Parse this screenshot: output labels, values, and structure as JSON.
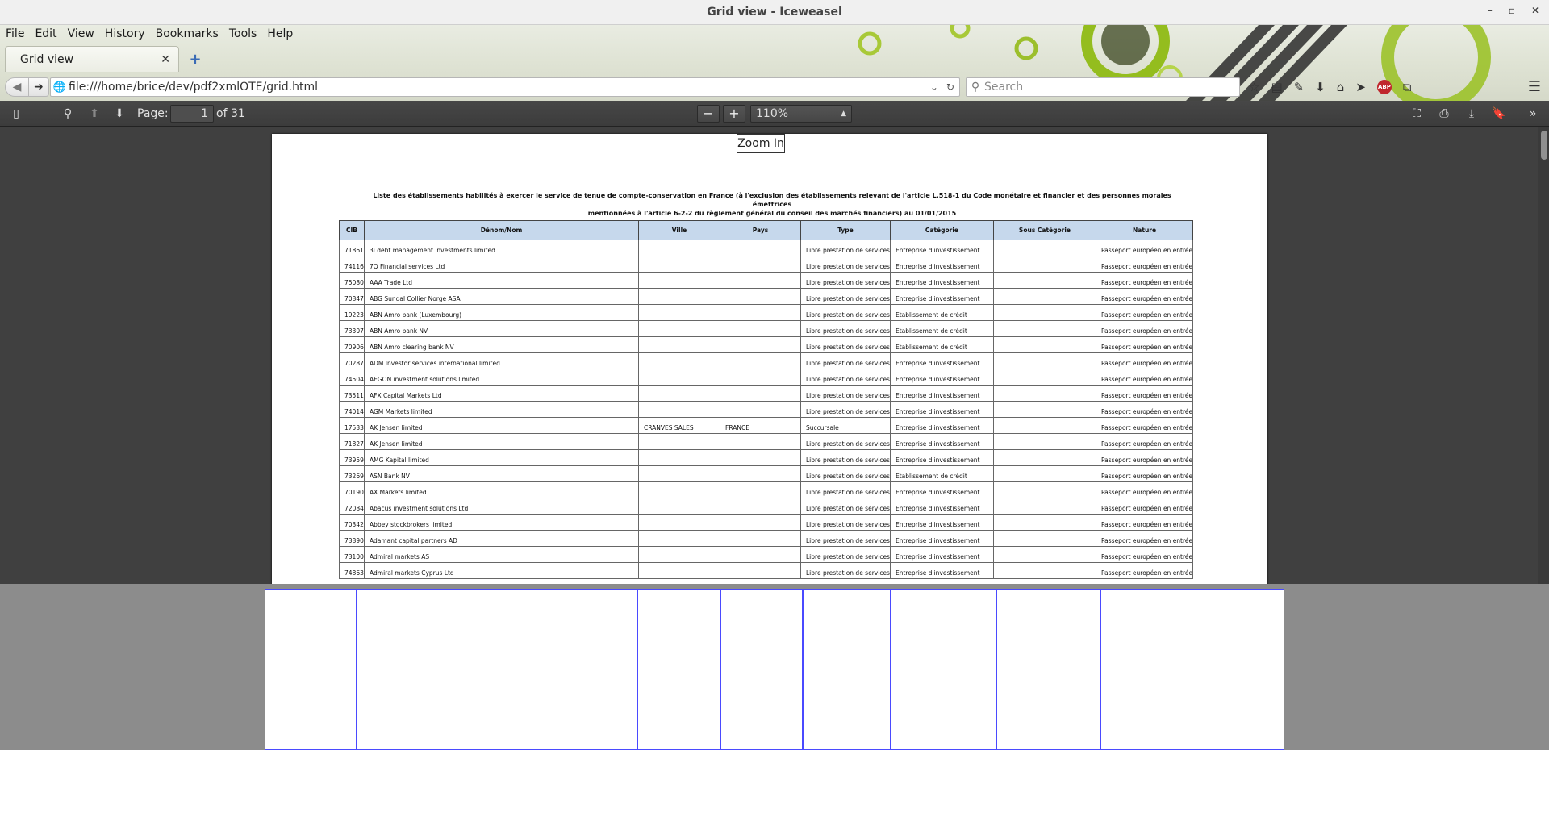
{
  "window": {
    "title": "Grid view - Iceweasel",
    "controls": [
      "–",
      "▫",
      "✕"
    ]
  },
  "menu": [
    "File",
    "Edit",
    "View",
    "History",
    "Bookmarks",
    "Tools",
    "Help"
  ],
  "tab": {
    "label": "Grid view",
    "close": "✕",
    "new": "+"
  },
  "nav": {
    "url": "file:///home/brice/dev/pdf2xmlOTE/grid.html",
    "search_placeholder": "Search",
    "abp": "ABP"
  },
  "pdf": {
    "page_label": "Page:",
    "page_value": "1",
    "page_total": "of 31",
    "zoom_value": "110%",
    "tooltip": "Zoom In"
  },
  "document": {
    "title_line1": "Liste des établissements habilités à exercer le service de tenue de compte-conservation en France (à l'exclusion des établissements relevant de l'article L.518-1 du Code monétaire et financier et des personnes morales émettrices",
    "title_line2": "mentionnées à l'article 6-2-2 du règlement général du conseil des marchés financiers) au 01/01/2015",
    "columns": [
      "CIB",
      "Dénom/Nom",
      "Ville",
      "Pays",
      "Type",
      "Catégorie",
      "Sous Catégorie",
      "Nature"
    ],
    "rows": [
      [
        "71861",
        "3i debt management investments limited",
        "",
        "",
        "Libre prestation de services",
        "Entreprise d'investissement",
        "",
        "Passeport européen en entrée"
      ],
      [
        "74116",
        "7Q Financial services Ltd",
        "",
        "",
        "Libre prestation de services",
        "Entreprise d'investissement",
        "",
        "Passeport européen en entrée"
      ],
      [
        "75080",
        "AAA Trade Ltd",
        "",
        "",
        "Libre prestation de services",
        "Entreprise d'investissement",
        "",
        "Passeport européen en entrée"
      ],
      [
        "70847",
        "ABG Sundal Collier Norge ASA",
        "",
        "",
        "Libre prestation de services",
        "Entreprise d'investissement",
        "",
        "Passeport européen en entrée"
      ],
      [
        "19223",
        "ABN Amro bank (Luxembourg)",
        "",
        "",
        "Libre prestation de services",
        "Etablissement de crédit",
        "",
        "Passeport européen en entrée"
      ],
      [
        "73307",
        "ABN Amro bank NV",
        "",
        "",
        "Libre prestation de services",
        "Etablissement de crédit",
        "",
        "Passeport européen en entrée"
      ],
      [
        "70906",
        "ABN Amro clearing bank NV",
        "",
        "",
        "Libre prestation de services",
        "Etablissement de crédit",
        "",
        "Passeport européen en entrée"
      ],
      [
        "70287",
        "ADM Investor services international limited",
        "",
        "",
        "Libre prestation de services",
        "Entreprise d'investissement",
        "",
        "Passeport européen en entrée"
      ],
      [
        "74504",
        "AEGON investment solutions limited",
        "",
        "",
        "Libre prestation de services",
        "Entreprise d'investissement",
        "",
        "Passeport européen en entrée"
      ],
      [
        "73511",
        "AFX Capital Markets Ltd",
        "",
        "",
        "Libre prestation de services",
        "Entreprise d'investissement",
        "",
        "Passeport européen en entrée"
      ],
      [
        "74014",
        "AGM Markets limited",
        "",
        "",
        "Libre prestation de services",
        "Entreprise d'investissement",
        "",
        "Passeport européen en entrée"
      ],
      [
        "17533",
        "AK Jensen limited",
        "CRANVES SALES",
        "FRANCE",
        "Succursale",
        "Entreprise d'investissement",
        "",
        "Passeport européen en entrée"
      ],
      [
        "71827",
        "AK Jensen limited",
        "",
        "",
        "Libre prestation de services",
        "Entreprise d'investissement",
        "",
        "Passeport européen en entrée"
      ],
      [
        "73959",
        "AMG Kapital limited",
        "",
        "",
        "Libre prestation de services",
        "Entreprise d'investissement",
        "",
        "Passeport européen en entrée"
      ],
      [
        "73269",
        "ASN Bank NV",
        "",
        "",
        "Libre prestation de services",
        "Etablissement de crédit",
        "",
        "Passeport européen en entrée"
      ],
      [
        "70190",
        "AX Markets limited",
        "",
        "",
        "Libre prestation de services",
        "Entreprise d'investissement",
        "",
        "Passeport européen en entrée"
      ],
      [
        "72084",
        "Abacus investment solutions Ltd",
        "",
        "",
        "Libre prestation de services",
        "Entreprise d'investissement",
        "",
        "Passeport européen en entrée"
      ],
      [
        "70342",
        "Abbey stockbrokers limited",
        "",
        "",
        "Libre prestation de services",
        "Entreprise d'investissement",
        "",
        "Passeport européen en entrée"
      ],
      [
        "73890",
        "Adamant capital partners AD",
        "",
        "",
        "Libre prestation de services",
        "Entreprise d'investissement",
        "",
        "Passeport européen en entrée"
      ],
      [
        "73100",
        "Admiral markets AS",
        "",
        "",
        "Libre prestation de services",
        "Entreprise d'investissement",
        "",
        "Passeport européen en entrée"
      ],
      [
        "74863",
        "Admiral markets Cyprus Ltd",
        "",
        "",
        "Libre prestation de services",
        "Entreprise d'investissement",
        "",
        "Passeport européen en entrée"
      ]
    ]
  }
}
